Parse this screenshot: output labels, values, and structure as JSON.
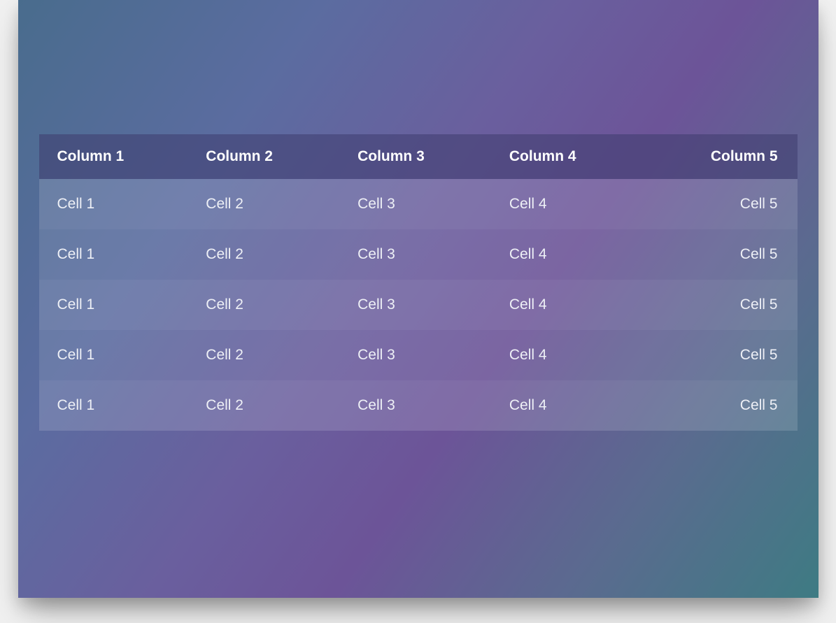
{
  "table": {
    "headers": [
      "Column 1",
      "Column 2",
      "Column 3",
      "Column 4",
      "Column 5"
    ],
    "rows": [
      [
        "Cell 1",
        "Cell 2",
        "Cell 3",
        "Cell 4",
        "Cell 5"
      ],
      [
        "Cell 1",
        "Cell 2",
        "Cell 3",
        "Cell 4",
        "Cell 5"
      ],
      [
        "Cell 1",
        "Cell 2",
        "Cell 3",
        "Cell 4",
        "Cell 5"
      ],
      [
        "Cell 1",
        "Cell 2",
        "Cell 3",
        "Cell 4",
        "Cell 5"
      ],
      [
        "Cell 1",
        "Cell 2",
        "Cell 3",
        "Cell 4",
        "Cell 5"
      ]
    ]
  }
}
